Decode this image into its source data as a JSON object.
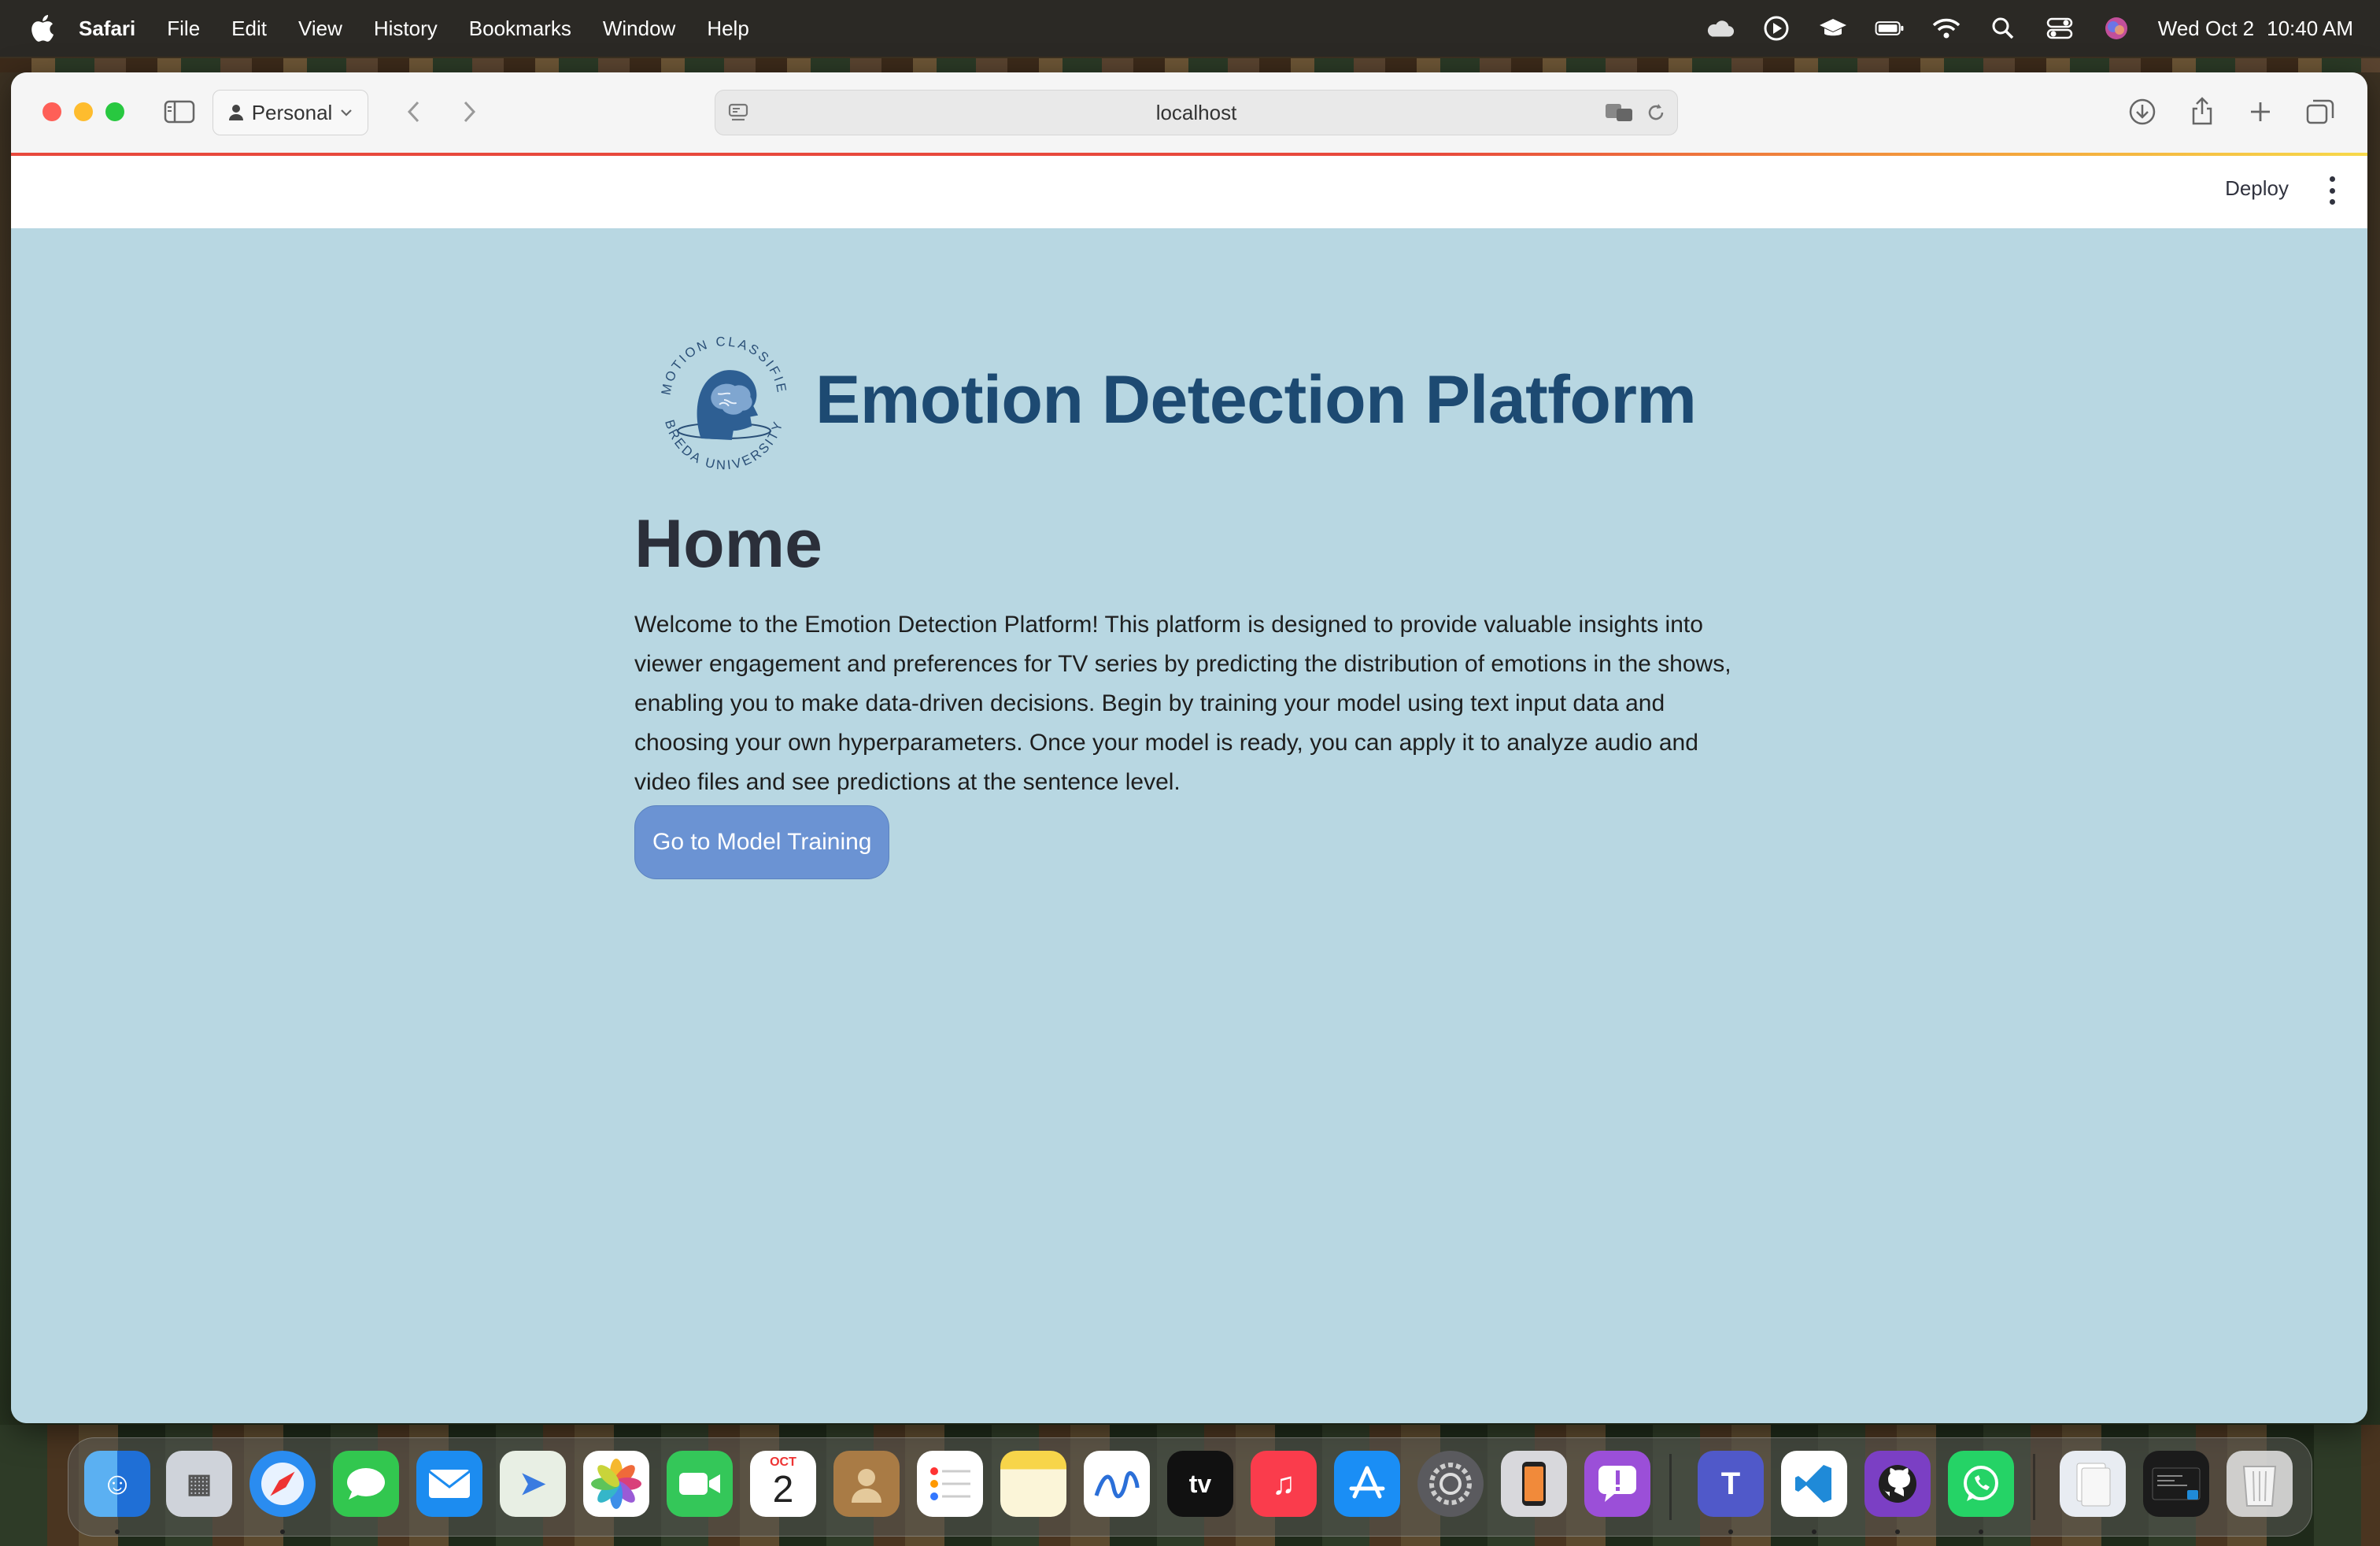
{
  "menubar": {
    "app_name": "Safari",
    "items": [
      "File",
      "Edit",
      "View",
      "History",
      "Bookmarks",
      "Window",
      "Help"
    ],
    "date": "Wed Oct 2",
    "time": "10:40 AM"
  },
  "browser": {
    "profile": "Personal",
    "url": "localhost"
  },
  "app": {
    "deploy_label": "Deploy",
    "logo_text_top": "EMOTION CLASSIFIER",
    "logo_text_bottom": "BREDA UNIVERSITY",
    "title": "Emotion Detection Platform",
    "heading": "Home",
    "description": "Welcome to the Emotion Detection Platform! This platform is designed to provide valuable insights into viewer engagement and preferences for TV series by predicting the distribution of emotions in the shows, enabling you to make data-driven decisions. Begin by training your model using text input data and choosing your own hyperparameters. Once your model is ready, you can apply it to analyze audio and video files and see predictions at the sentence level.",
    "cta_label": "Go to Model Training"
  },
  "dock": {
    "calendar_month": "OCT",
    "calendar_day": "2",
    "tv_label": "tv"
  },
  "colors": {
    "page_bg": "#b8d7e2",
    "title": "#1d4a72",
    "heading": "#2b2f3a",
    "button": "#6b93d3"
  }
}
